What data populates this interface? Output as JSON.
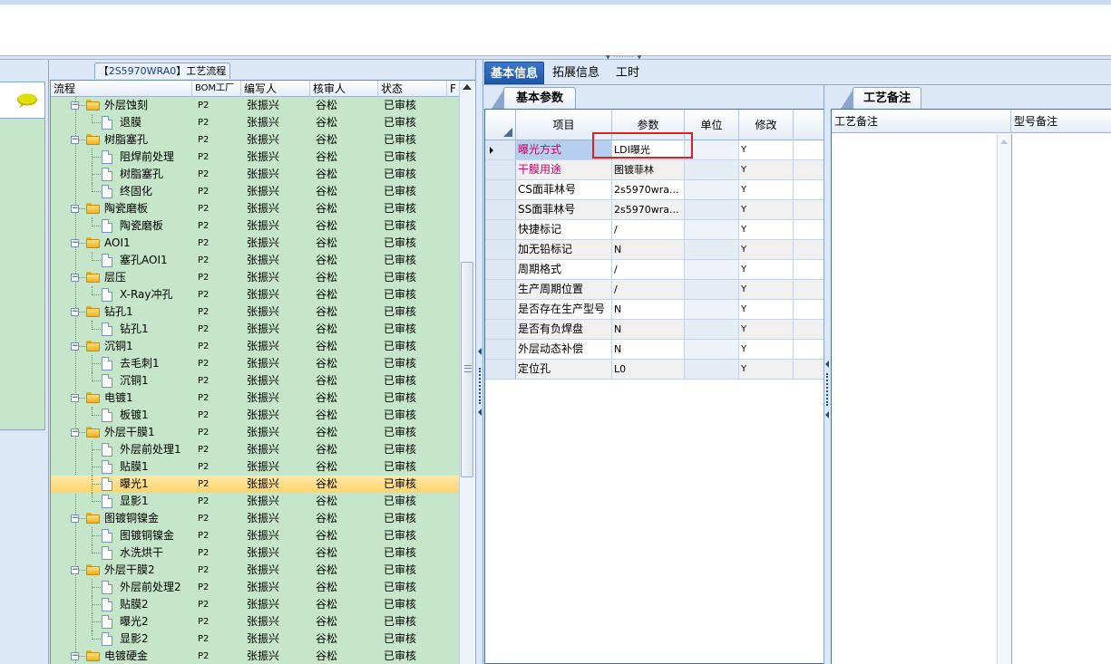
{
  "process_tab": {
    "prefix": "【",
    "code": "2S5970WRA0",
    "suffix": "】工艺流程"
  },
  "tree": {
    "columns": [
      "流程",
      "BOM工厂",
      "编写人",
      "核审人",
      "状态",
      "F"
    ],
    "rows": [
      {
        "level": 0,
        "name": "外层蚀刻",
        "bom": "P2",
        "author": "张振兴",
        "reviewer": "谷松",
        "status": "已审核"
      },
      {
        "level": 1,
        "name": "退膜",
        "bom": "P2",
        "author": "张振兴",
        "reviewer": "谷松",
        "status": "已审核"
      },
      {
        "level": 0,
        "name": "树脂塞孔",
        "bom": "P2",
        "author": "张振兴",
        "reviewer": "谷松",
        "status": "已审核"
      },
      {
        "level": 1,
        "name": "阻焊前处理",
        "bom": "P2",
        "author": "张振兴",
        "reviewer": "谷松",
        "status": "已审核"
      },
      {
        "level": 1,
        "name": "树脂塞孔",
        "bom": "P2",
        "author": "张振兴",
        "reviewer": "谷松",
        "status": "已审核"
      },
      {
        "level": 1,
        "name": "终固化",
        "bom": "P2",
        "author": "张振兴",
        "reviewer": "谷松",
        "status": "已审核"
      },
      {
        "level": 0,
        "name": "陶瓷磨板",
        "bom": "P2",
        "author": "张振兴",
        "reviewer": "谷松",
        "status": "已审核"
      },
      {
        "level": 1,
        "name": "陶瓷磨板",
        "bom": "P2",
        "author": "张振兴",
        "reviewer": "谷松",
        "status": "已审核"
      },
      {
        "level": 0,
        "name": "AOI1",
        "bom": "P2",
        "author": "张振兴",
        "reviewer": "谷松",
        "status": "已审核"
      },
      {
        "level": 1,
        "name": "塞孔AOI1",
        "bom": "P2",
        "author": "张振兴",
        "reviewer": "谷松",
        "status": "已审核"
      },
      {
        "level": 0,
        "name": "层压",
        "bom": "P2",
        "author": "张振兴",
        "reviewer": "谷松",
        "status": "已审核"
      },
      {
        "level": 1,
        "name": "X-Ray冲孔",
        "bom": "P2",
        "author": "张振兴",
        "reviewer": "谷松",
        "status": "已审核"
      },
      {
        "level": 0,
        "name": "钻孔1",
        "bom": "P2",
        "author": "张振兴",
        "reviewer": "谷松",
        "status": "已审核"
      },
      {
        "level": 1,
        "name": "钻孔1",
        "bom": "P2",
        "author": "张振兴",
        "reviewer": "谷松",
        "status": "已审核"
      },
      {
        "level": 0,
        "name": "沉铜1",
        "bom": "P2",
        "author": "张振兴",
        "reviewer": "谷松",
        "status": "已审核"
      },
      {
        "level": 1,
        "name": "去毛刺1",
        "bom": "P2",
        "author": "张振兴",
        "reviewer": "谷松",
        "status": "已审核"
      },
      {
        "level": 1,
        "name": "沉铜1",
        "bom": "P2",
        "author": "张振兴",
        "reviewer": "谷松",
        "status": "已审核"
      },
      {
        "level": 0,
        "name": "电镀1",
        "bom": "P2",
        "author": "张振兴",
        "reviewer": "谷松",
        "status": "已审核"
      },
      {
        "level": 1,
        "name": "板镀1",
        "bom": "P2",
        "author": "张振兴",
        "reviewer": "谷松",
        "status": "已审核"
      },
      {
        "level": 0,
        "name": "外层干膜1",
        "bom": "P2",
        "author": "张振兴",
        "reviewer": "谷松",
        "status": "已审核"
      },
      {
        "level": 1,
        "name": "外层前处理1",
        "bom": "P2",
        "author": "张振兴",
        "reviewer": "谷松",
        "status": "已审核"
      },
      {
        "level": 1,
        "name": "贴膜1",
        "bom": "P2",
        "author": "张振兴",
        "reviewer": "谷松",
        "status": "已审核"
      },
      {
        "level": 1,
        "name": "曝光1",
        "bom": "P2",
        "author": "张振兴",
        "reviewer": "谷松",
        "status": "已审核",
        "selected": true
      },
      {
        "level": 1,
        "name": "显影1",
        "bom": "P2",
        "author": "张振兴",
        "reviewer": "谷松",
        "status": "已审核"
      },
      {
        "level": 0,
        "name": "图镀铜镍金",
        "bom": "P2",
        "author": "张振兴",
        "reviewer": "谷松",
        "status": "已审核"
      },
      {
        "level": 1,
        "name": "图镀铜镍金",
        "bom": "P2",
        "author": "张振兴",
        "reviewer": "谷松",
        "status": "已审核"
      },
      {
        "level": 1,
        "name": "水洗烘干",
        "bom": "P2",
        "author": "张振兴",
        "reviewer": "谷松",
        "status": "已审核"
      },
      {
        "level": 0,
        "name": "外层干膜2",
        "bom": "P2",
        "author": "张振兴",
        "reviewer": "谷松",
        "status": "已审核"
      },
      {
        "level": 1,
        "name": "外层前处理2",
        "bom": "P2",
        "author": "张振兴",
        "reviewer": "谷松",
        "status": "已审核"
      },
      {
        "level": 1,
        "name": "贴膜2",
        "bom": "P2",
        "author": "张振兴",
        "reviewer": "谷松",
        "status": "已审核"
      },
      {
        "level": 1,
        "name": "曝光2",
        "bom": "P2",
        "author": "张振兴",
        "reviewer": "谷松",
        "status": "已审核"
      },
      {
        "level": 1,
        "name": "显影2",
        "bom": "P2",
        "author": "张振兴",
        "reviewer": "谷松",
        "status": "已审核"
      },
      {
        "level": 0,
        "name": "电镀硬金",
        "bom": "P2",
        "author": "张振兴",
        "reviewer": "谷松",
        "status": "已审核"
      }
    ]
  },
  "right_tabs": [
    "基本信息",
    "拓展信息",
    "工时"
  ],
  "params_section": "基本参数",
  "params_grid": {
    "columns": [
      "项目",
      "参数",
      "单位",
      "修改"
    ],
    "rows": [
      {
        "item": "曝光方式",
        "value": "LDI曝光",
        "unit": "",
        "modified": "Y",
        "highlight": true
      },
      {
        "item": "干膜用途",
        "value": "图镀菲林",
        "unit": "",
        "modified": "Y",
        "highlight": true
      },
      {
        "item": "CS面菲林号",
        "value": "2s5970wra...",
        "unit": "",
        "modified": "Y"
      },
      {
        "item": "SS面菲林号",
        "value": "2s5970wra...",
        "unit": "",
        "modified": "Y"
      },
      {
        "item": "快捷标记",
        "value": "/",
        "unit": "",
        "modified": "Y"
      },
      {
        "item": "加无铅标记",
        "value": "N",
        "unit": "",
        "modified": "Y"
      },
      {
        "item": "周期格式",
        "value": "/",
        "unit": "",
        "modified": "Y"
      },
      {
        "item": "生产周期位置",
        "value": "/",
        "unit": "",
        "modified": "Y"
      },
      {
        "item": "是否存在生产型号",
        "value": "N",
        "unit": "",
        "modified": "Y"
      },
      {
        "item": "是否有负焊盘",
        "value": "N",
        "unit": "",
        "modified": "Y"
      },
      {
        "item": "外层动态补偿",
        "value": "N",
        "unit": "",
        "modified": "Y"
      },
      {
        "item": "定位孔",
        "value": "L0",
        "unit": "",
        "modified": "Y"
      }
    ]
  },
  "notes_section": "工艺备注",
  "notes_columns": [
    "工艺备注",
    "型号备注"
  ]
}
